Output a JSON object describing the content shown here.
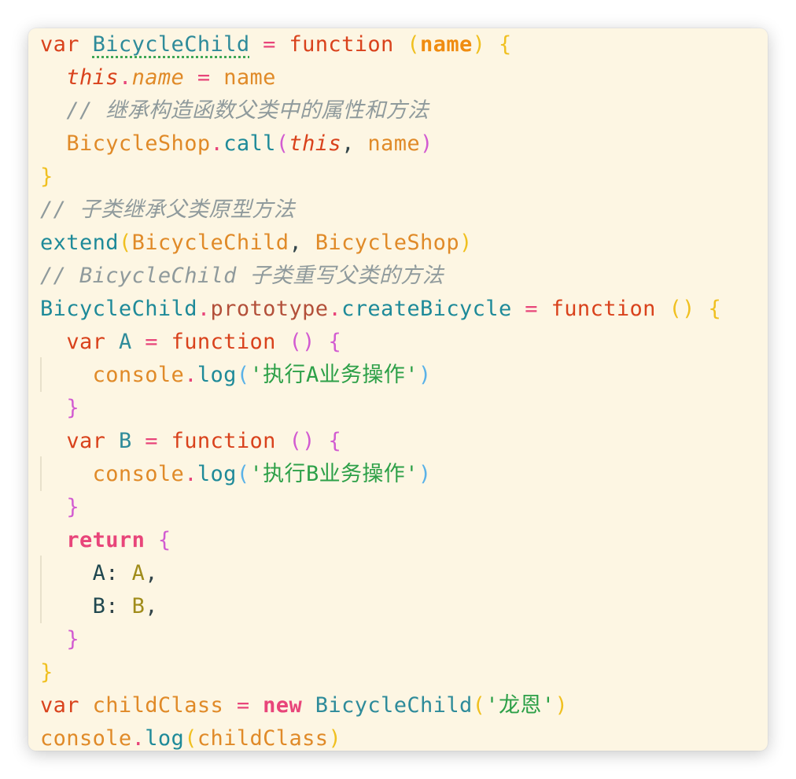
{
  "code_lines": [
    [
      [
        "kw",
        "var "
      ],
      [
        "def",
        "BicycleChild"
      ],
      [
        "plain",
        " "
      ],
      [
        "op",
        "="
      ],
      [
        "plain",
        " "
      ],
      [
        "kw",
        "function"
      ],
      [
        "plain",
        " "
      ],
      [
        "paren1",
        "("
      ],
      [
        "param",
        "name"
      ],
      [
        "paren1",
        ")"
      ],
      [
        "plain",
        " "
      ],
      [
        "paren1",
        "{"
      ]
    ],
    [
      [
        "plain",
        "  "
      ],
      [
        "this",
        "this"
      ],
      [
        "dot",
        "."
      ],
      [
        "prop",
        "name"
      ],
      [
        "plain",
        " "
      ],
      [
        "op",
        "="
      ],
      [
        "plain",
        " "
      ],
      [
        "var",
        "name"
      ]
    ],
    [
      [
        "plain",
        "  "
      ],
      [
        "cmt",
        "// 继承构造函数父类中的属性和方法"
      ]
    ],
    [
      [
        "plain",
        "  "
      ],
      [
        "cls",
        "BicycleShop"
      ],
      [
        "dot",
        "."
      ],
      [
        "fn",
        "call"
      ],
      [
        "paren2",
        "("
      ],
      [
        "this",
        "this"
      ],
      [
        "plain",
        ", "
      ],
      [
        "var",
        "name"
      ],
      [
        "paren2",
        ")"
      ]
    ],
    [
      [
        "paren1",
        "}"
      ]
    ],
    [
      [
        "cmt",
        "// 子类继承父类原型方法"
      ]
    ],
    [
      [
        "fn",
        "extend"
      ],
      [
        "paren1",
        "("
      ],
      [
        "cls",
        "BicycleChild"
      ],
      [
        "plain",
        ", "
      ],
      [
        "cls",
        "BicycleShop"
      ],
      [
        "paren1",
        ")"
      ]
    ],
    [
      [
        "cmt",
        "// BicycleChild 子类重写父类的方法"
      ]
    ],
    [
      [
        "fn",
        "BicycleChild"
      ],
      [
        "dot",
        "."
      ],
      [
        "proto",
        "prototype"
      ],
      [
        "dot",
        "."
      ],
      [
        "fn",
        "createBicycle"
      ],
      [
        "plain",
        " "
      ],
      [
        "op",
        "="
      ],
      [
        "plain",
        " "
      ],
      [
        "kw",
        "function"
      ],
      [
        "plain",
        " "
      ],
      [
        "paren1",
        "()"
      ],
      [
        "plain",
        " "
      ],
      [
        "paren1",
        "{"
      ]
    ],
    [
      [
        "plain",
        "  "
      ],
      [
        "kw",
        "var "
      ],
      [
        "def",
        "A"
      ],
      [
        "plain",
        " "
      ],
      [
        "op",
        "="
      ],
      [
        "plain",
        " "
      ],
      [
        "kw",
        "function"
      ],
      [
        "plain",
        " "
      ],
      [
        "paren2",
        "()"
      ],
      [
        "plain",
        " "
      ],
      [
        "paren2",
        "{"
      ]
    ],
    [
      [
        "plain",
        "    "
      ],
      [
        "var",
        "console"
      ],
      [
        "dot",
        "."
      ],
      [
        "fn",
        "log"
      ],
      [
        "paren3",
        "("
      ],
      [
        "str",
        "'执行A业务操作'"
      ],
      [
        "paren3",
        ")"
      ]
    ],
    [
      [
        "plain",
        "  "
      ],
      [
        "paren2",
        "}"
      ]
    ],
    [
      [
        "plain",
        "  "
      ],
      [
        "kw",
        "var "
      ],
      [
        "def",
        "B"
      ],
      [
        "plain",
        " "
      ],
      [
        "op",
        "="
      ],
      [
        "plain",
        " "
      ],
      [
        "kw",
        "function"
      ],
      [
        "plain",
        " "
      ],
      [
        "paren2",
        "()"
      ],
      [
        "plain",
        " "
      ],
      [
        "paren2",
        "{"
      ]
    ],
    [
      [
        "plain",
        "    "
      ],
      [
        "var",
        "console"
      ],
      [
        "dot",
        "."
      ],
      [
        "fn",
        "log"
      ],
      [
        "paren3",
        "("
      ],
      [
        "str",
        "'执行B业务操作'"
      ],
      [
        "paren3",
        ")"
      ]
    ],
    [
      [
        "plain",
        "  "
      ],
      [
        "paren2",
        "}"
      ]
    ],
    [
      [
        "plain",
        "  "
      ],
      [
        "kw2",
        "return"
      ],
      [
        "plain",
        " "
      ],
      [
        "paren2",
        "{"
      ]
    ],
    [
      [
        "plain",
        "    "
      ],
      [
        "key",
        "A"
      ],
      [
        "plain",
        ": "
      ],
      [
        "val",
        "A"
      ],
      [
        "plain",
        ","
      ]
    ],
    [
      [
        "plain",
        "    "
      ],
      [
        "key",
        "B"
      ],
      [
        "plain",
        ": "
      ],
      [
        "val",
        "B"
      ],
      [
        "plain",
        ","
      ]
    ],
    [
      [
        "plain",
        "  "
      ],
      [
        "paren2",
        "}"
      ]
    ],
    [
      [
        "paren1",
        "}"
      ]
    ],
    [
      [
        "kw",
        "var "
      ],
      [
        "var",
        "childClass"
      ],
      [
        "plain",
        " "
      ],
      [
        "op",
        "="
      ],
      [
        "plain",
        " "
      ],
      [
        "kw2",
        "new"
      ],
      [
        "plain",
        " "
      ],
      [
        "cls2",
        "BicycleChild"
      ],
      [
        "paren1",
        "("
      ],
      [
        "str",
        "'龙恩'"
      ],
      [
        "paren1",
        ")"
      ]
    ],
    [
      [
        "var",
        "console"
      ],
      [
        "dot",
        "."
      ],
      [
        "fn",
        "log"
      ],
      [
        "paren1",
        "("
      ],
      [
        "var",
        "childClass"
      ],
      [
        "paren1",
        ")"
      ]
    ]
  ],
  "colors": {
    "background": "#fdf6e3",
    "keyword": "#d9421c",
    "string": "#2da048",
    "comment": "#8f9a9c",
    "function": "#1e8a99"
  }
}
